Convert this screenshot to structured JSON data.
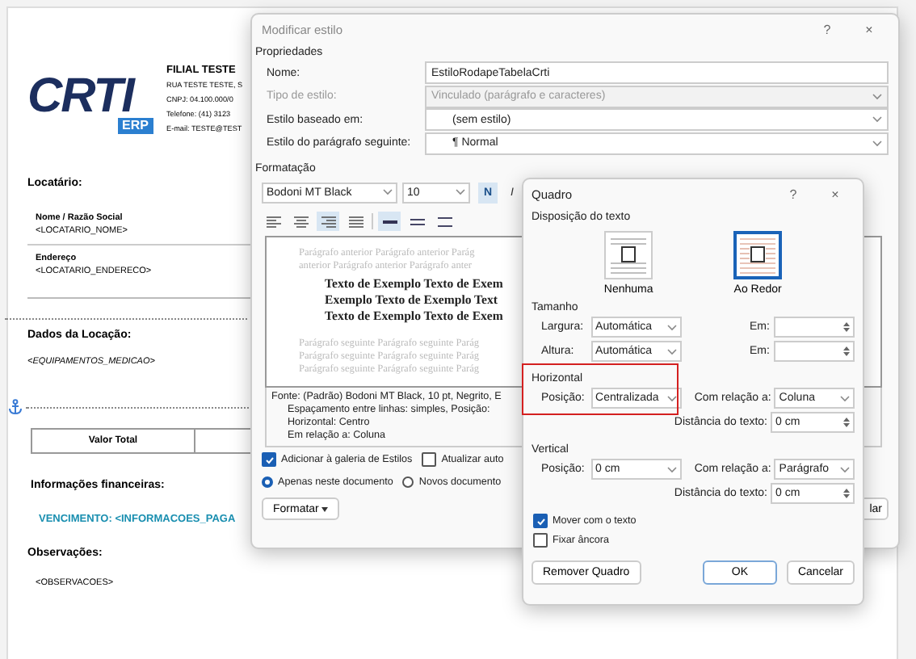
{
  "document": {
    "logo": {
      "text": "CRTI",
      "badge": "ERP"
    },
    "company": {
      "name": "FILIAL TESTE",
      "lines": [
        "RUA TESTE TESTE, S",
        "CNPJ: 04.100.000/0",
        "Telefone: (41) 3123",
        "E-mail: TESTE@TEST"
      ]
    },
    "tenant_heading": "Locatário:",
    "tenant_fields": [
      {
        "label": "Nome / Razão Social",
        "value": "<LOCATARIO_NOME>"
      },
      {
        "label": "Endereço",
        "value": "<LOCATARIO_ENDERECO>"
      }
    ],
    "rental_heading": "Dados da Locação:",
    "rental_value": "<EQUIPAMENTOS_MEDICAO>",
    "table_columns": [
      "Valor Total"
    ],
    "finance_heading": "Informações financeiras:",
    "due_line": "VENCIMENTO: <INFORMACOES_PAGA",
    "notes_heading": "Observações:",
    "notes_value": "<OBSERVACOES>"
  },
  "modify_style": {
    "title": "Modificar estilo",
    "help": "?",
    "close": "×",
    "properties_heading": "Propriedades",
    "fields": [
      {
        "label": "Nome:",
        "value": "EstiloRodapeTabelaCrti",
        "kind": "text",
        "disabled": false
      },
      {
        "label": "Tipo de estilo:",
        "value": "Vinculado (parágrafo e caracteres)",
        "kind": "dropdown",
        "disabled": true
      },
      {
        "label": "Estilo baseado em:",
        "value": "(sem estilo)",
        "kind": "dropdown",
        "disabled": false
      },
      {
        "label": "Estilo do parágrafo seguinte:",
        "value": "¶ Normal",
        "kind": "dropdown",
        "disabled": false
      }
    ],
    "formatting_heading": "Formatação",
    "font": "Bodoni MT Black",
    "size": "10",
    "style_buttons": [
      {
        "label": "N",
        "on": true
      },
      {
        "label": "I",
        "on": false
      }
    ],
    "align_buttons": [
      {
        "selected": false
      },
      {
        "selected": false
      },
      {
        "selected": true
      },
      {
        "selected": false
      }
    ],
    "spacing_buttons": [
      {
        "selected": true
      },
      {
        "selected": false
      },
      {
        "selected": false
      }
    ],
    "preview_before": [
      "Parágrafo anterior Parágrafo anterior Parág",
      "anterior Parágrafo anterior Parágrafo anter"
    ],
    "preview_sample": [
      "Texto de Exemplo Texto de Exem",
      "Exemplo Texto de Exemplo Text",
      "Texto de Exemplo Texto de Exem"
    ],
    "preview_after": [
      "Parágrafo seguinte Parágrafo seguinte Parág",
      "Parágrafo seguinte Parágrafo seguinte Parág",
      "Parágrafo seguinte Parágrafo seguinte Parág"
    ],
    "description": [
      "Fonte: (Padrão) Bodoni MT Black, 10 pt, Negrito, E",
      "Espaçamento entre linhas:  simples, Posição:",
      "Horizontal: Centro",
      "Em relação a: Coluna"
    ],
    "checkboxes": [
      {
        "label": "Adicionar à galeria de Estilos",
        "checked": true
      },
      {
        "label": "Atualizar auto",
        "checked": false
      }
    ],
    "radios": [
      {
        "label": "Apenas neste documento",
        "selected": true
      },
      {
        "label": "Novos documento",
        "selected": false
      }
    ],
    "format_button": "Formatar",
    "cancel_button": "lar"
  },
  "frame": {
    "title": "Quadro",
    "help": "?",
    "close": "×",
    "wrap_heading": "Disposição do texto",
    "wrap_options": [
      {
        "label": "Nenhuma",
        "selected": false
      },
      {
        "label": "Ao Redor",
        "selected": true
      }
    ],
    "size_heading": "Tamanho",
    "size_rows": [
      {
        "label": "Largura:",
        "value": "Automática",
        "at_label": "Em:"
      },
      {
        "label": "Altura:",
        "value": "Automática",
        "at_label": "Em:"
      }
    ],
    "horizontal": {
      "heading": "Horizontal",
      "highlighted": true,
      "position_label": "Posição:",
      "position": "Centralizada",
      "relative_label": "Com relação a:",
      "relative": "Coluna",
      "distance_label": "Distância do texto:",
      "distance": "0 cm"
    },
    "vertical": {
      "heading": "Vertical",
      "position_label": "Posição:",
      "position": "0 cm",
      "relative_label": "Com relação a:",
      "relative": "Parágrafo",
      "distance_label": "Distância do texto:",
      "distance": "0 cm"
    },
    "checkboxes": [
      {
        "label": "Mover com o texto",
        "checked": true
      },
      {
        "label": "Fixar âncora",
        "checked": false
      }
    ],
    "remove_button": "Remover Quadro",
    "ok_button": "OK",
    "cancel_button": "Cancelar"
  }
}
